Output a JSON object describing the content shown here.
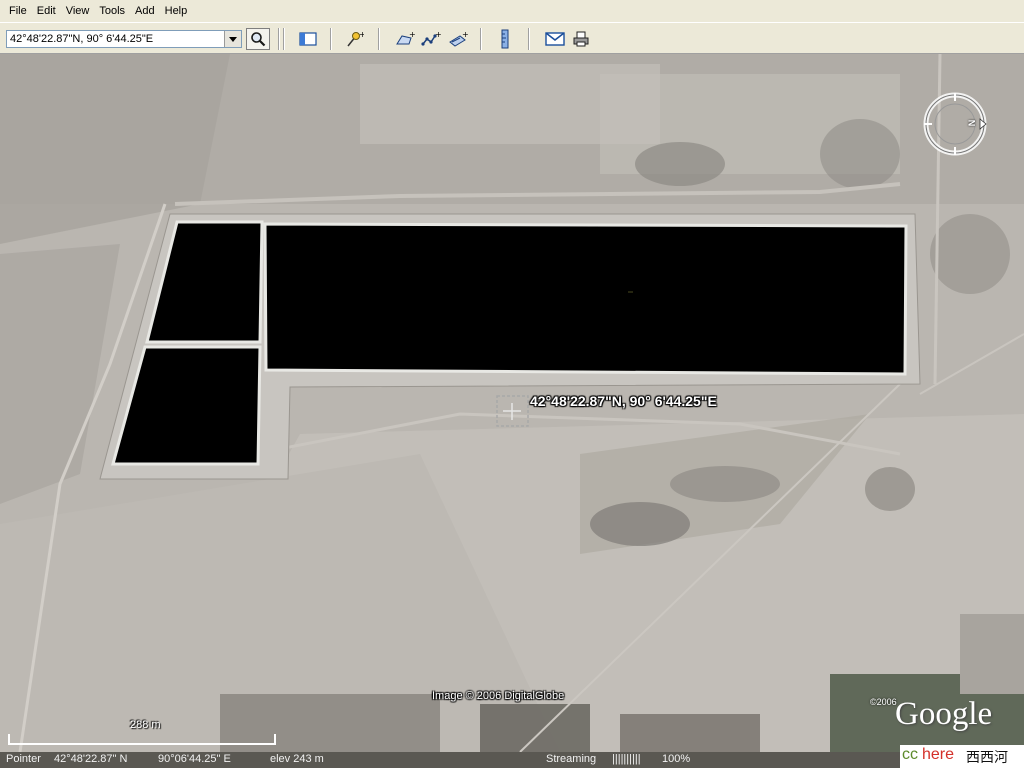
{
  "menu": {
    "file": "File",
    "edit": "Edit",
    "view": "View",
    "tools": "Tools",
    "add": "Add",
    "help": "Help"
  },
  "toolbar": {
    "search_value": "42°48'22.87\"N, 90° 6'44.25\"E",
    "icons": [
      "search-icon",
      "sidebar-toggle-icon",
      "placemark-icon",
      "polygon-icon",
      "path-icon",
      "image-overlay-icon",
      "ruler-icon",
      "email-icon",
      "print-icon"
    ]
  },
  "map": {
    "placemark_label": "42°48'22.87\"N, 90° 6'44.25\"E",
    "image_credit": "Image © 2006 DigitalGlobe",
    "scale_label": "288 m",
    "copyright_year": "©2006",
    "logo_text": "Google",
    "compass_letter": "N"
  },
  "status": {
    "pointer_prefix": "Pointer",
    "pointer_lat": "42°48'22.87\"  N",
    "pointer_lon": "90°06'44.25\"  E",
    "elevation": "elev  243 m",
    "streaming_label": "Streaming",
    "streaming_bars": "||||||||||",
    "streaming_percent": "100%"
  },
  "watermark": {
    "prefix": "cc",
    "word": "here",
    "chinese": "西西河"
  },
  "colors": {
    "ground": "#b8b4ae",
    "reservoir": "#000000",
    "embankment": "#e8e8e4",
    "status_bg": "#5a5852",
    "watermark_accent": "#d4302a"
  }
}
